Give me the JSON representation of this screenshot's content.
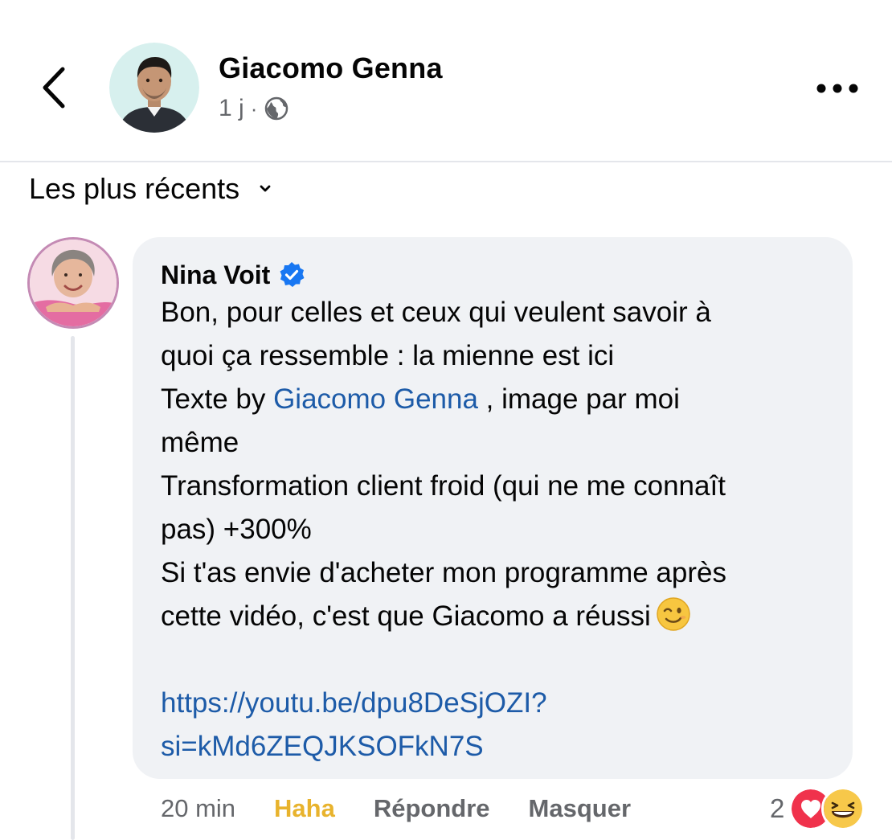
{
  "header": {
    "author_name": "Giacomo Genna",
    "post_time": "1 j",
    "separator": "·"
  },
  "sort": {
    "label": "Les plus récents"
  },
  "comment": {
    "author_name": "Nina Voit",
    "text_lines": {
      "l1": "Bon, pour celles et ceux qui veulent savoir à",
      "l2": "quoi ça ressemble : la mienne est ici",
      "l3_before": "Texte by ",
      "l3_mention": "Giacomo Genna",
      "l3_after": " , image par moi",
      "l4": "même",
      "l5": "Transformation client froid (qui ne me connaît",
      "l6": "pas) +300%",
      "l7": "Si t'as envie d'acheter mon programme après",
      "l8": "cette vidéo, c'est que Giacomo a réussi"
    },
    "link_line1": "https://youtu.be/dpu8DeSjOZI?",
    "link_line2": "si=kMd6ZEQJKSOFkN7S",
    "time": "20 min",
    "actions": {
      "haha": "Haha",
      "reply": "Répondre",
      "hide": "Masquer"
    },
    "reaction_count": "2",
    "reaction_icons": [
      "love-icon",
      "haha-icon"
    ],
    "inline_emoji": "wink-emoji-icon"
  },
  "colors": {
    "link": "#1d5ba8",
    "haha_action": "#e8b32d",
    "bubble_bg": "#f0f2f5",
    "secondary_text": "#65676b",
    "verified": "#1877f2"
  }
}
